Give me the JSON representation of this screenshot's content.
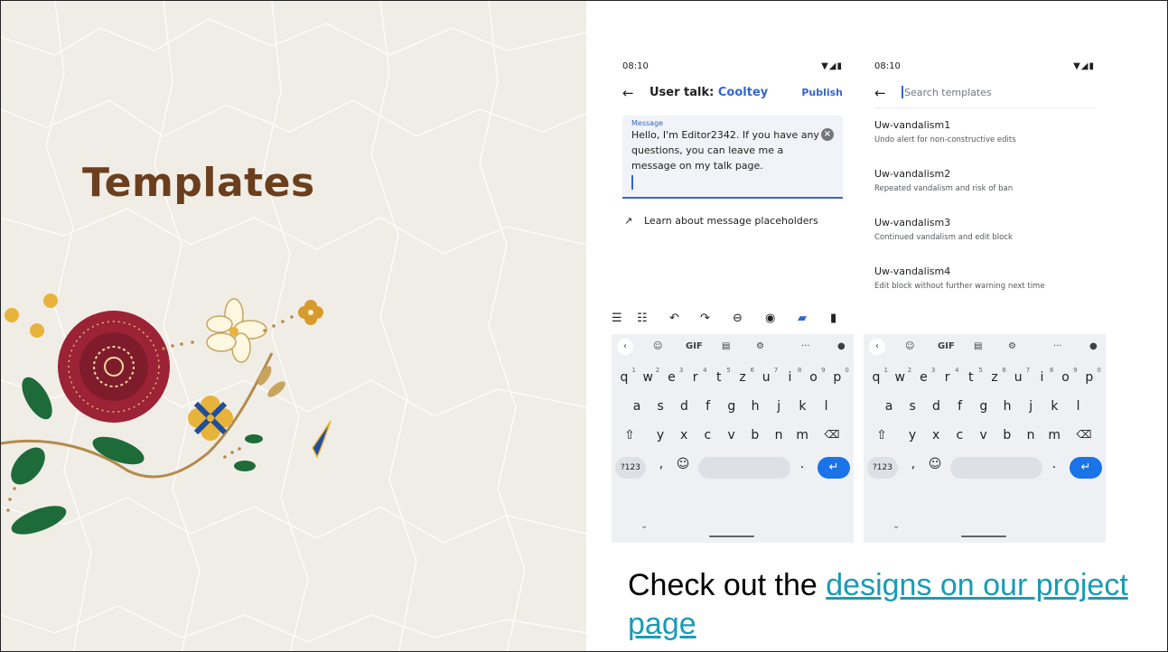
{
  "slide": {
    "title": "Templates",
    "caption_prefix": "Check out the ",
    "caption_link": "designs on our project page"
  },
  "colors": {
    "title": "#6b3f1d",
    "accent": "#3366cc",
    "link": "#1a9bb5",
    "enter": "#1a73e8"
  },
  "editor_screen": {
    "status_time": "08:10",
    "status_icons": "▼◢▮",
    "back_icon": "arrow-left-icon",
    "title_prefix": "User talk: ",
    "title_user": "Cooltey",
    "publish_label": "Publish",
    "message_label": "Message",
    "message_text": "Hello, I'm Editor2342. If you have any questions, you can leave me a message on my talk page.",
    "clear_icon": "clear-icon",
    "learn_link": "Learn about message placeholders",
    "toolbar_icons": [
      "list-icon",
      "numbered-list-icon",
      "undo-icon",
      "redo-icon",
      "link-icon",
      "preview-icon",
      "template-icon",
      "save-icon"
    ]
  },
  "template_screen": {
    "status_time": "08:10",
    "status_icons": "▼◢▮",
    "search_placeholder": "Search templates",
    "templates": [
      {
        "name": "Uw-vandalism1",
        "desc": "Undo alert for non-constructive edits"
      },
      {
        "name": "Uw-vandalism2",
        "desc": "Repeated vandalism and risk of ban"
      },
      {
        "name": "Uw-vandalism3",
        "desc": "Continued vandalism and edit block"
      },
      {
        "name": "Uw-vandalism4",
        "desc": "Edit block without further warning next time"
      }
    ]
  },
  "keyboard": {
    "top_gif": "GIF",
    "top_more": "···",
    "row1": [
      "q",
      "w",
      "e",
      "r",
      "t",
      "z",
      "u",
      "i",
      "o",
      "p"
    ],
    "row1_nums": [
      "1",
      "2",
      "3",
      "4",
      "5",
      "6",
      "7",
      "8",
      "9",
      "0"
    ],
    "row2": [
      "a",
      "s",
      "d",
      "f",
      "g",
      "h",
      "j",
      "k",
      "l"
    ],
    "row3": [
      "y",
      "x",
      "c",
      "v",
      "b",
      "n",
      "m"
    ],
    "num_key": "?123",
    "comma": ",",
    "period": "."
  }
}
